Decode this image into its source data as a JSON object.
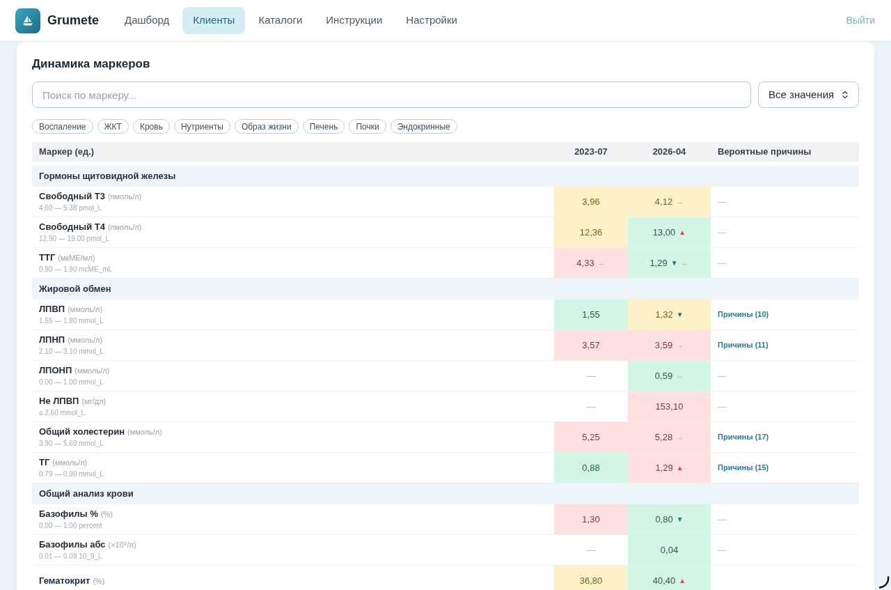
{
  "nav": {
    "brand": "Grumete",
    "items": [
      {
        "label": "Дашборд",
        "selected": false
      },
      {
        "label": "Клиенты",
        "selected": true
      },
      {
        "label": "Каталоги",
        "selected": false
      },
      {
        "label": "Инструкции",
        "selected": false
      },
      {
        "label": "Настройки",
        "selected": false
      }
    ],
    "logout": "Выйти"
  },
  "panel": {
    "title": "Динамика маркеров",
    "search": {
      "placeholder": "Поиск по маркеру..."
    },
    "filter": {
      "value": "Все значения"
    },
    "tags": [
      "Воспаление",
      "ЖКТ",
      "Кровь",
      "Нутриенты",
      "Образ жизни",
      "Печень",
      "Почки",
      "Эндокринные"
    ],
    "table": {
      "columns": [
        "Маркер (ед.)",
        "2023-07",
        "2026-04",
        "Вероятные причины"
      ],
      "groups": [
        {
          "name": "Гормоны щитовидной железы",
          "rows": [
            {
              "name": "Свободный Т3",
              "unit": "(пмоль/л)",
              "range": "4.60 — 5.38 pmol_L",
              "values": [
                {
                  "text": "3,96",
                  "color": "#fdf1c7"
                },
                {
                  "text": "4,12",
                  "color": "#fdf1c7",
                  "trends": [
                    {
                      "kind": "flat",
                      "symbol": "→"
                    }
                  ]
                }
              ],
              "causes": {
                "kind": "empty",
                "text": "—"
              }
            },
            {
              "name": "Свободный Т4",
              "unit": "(пмоль/л)",
              "range": "12.90 — 19.00 pmol_L",
              "values": [
                {
                  "text": "12,36",
                  "color": "#fdf1c7"
                },
                {
                  "text": "13,00",
                  "color": "#d3f5e5",
                  "trends": [
                    {
                      "kind": "up",
                      "symbol": "▲"
                    }
                  ]
                }
              ],
              "causes": {
                "kind": "empty",
                "text": "—"
              }
            },
            {
              "name": "ТТГ",
              "unit": "(мкМЕ/мл)",
              "range": "0.90 — 1.90 mcME_mL",
              "values": [
                {
                  "text": "4,33",
                  "color": "#fde1e1",
                  "trends": [
                    {
                      "kind": "range",
                      "symbol": "↔"
                    }
                  ]
                },
                {
                  "text": "1,29",
                  "color": "#d3f5e5",
                  "trends": [
                    {
                      "kind": "down",
                      "symbol": "▼"
                    },
                    {
                      "kind": "range",
                      "symbol": "↔"
                    }
                  ]
                }
              ],
              "causes": {
                "kind": "empty",
                "text": "—"
              }
            }
          ]
        },
        {
          "name": "Жировой обмен",
          "rows": [
            {
              "name": "ЛПВП",
              "unit": "(ммоль/л)",
              "range": "1.55 — 1.80 mmol_L",
              "values": [
                {
                  "text": "1,55",
                  "color": "#d3f5e5"
                },
                {
                  "text": "1,32",
                  "color": "#fdf1c7",
                  "trends": [
                    {
                      "kind": "down",
                      "symbol": "▼"
                    }
                  ]
                }
              ],
              "causes": {
                "kind": "link",
                "text": "Причины (10)"
              }
            },
            {
              "name": "ЛПНП",
              "unit": "(ммоль/л)",
              "range": "2.10 — 3.10 mmol_L",
              "values": [
                {
                  "text": "3,57",
                  "color": "#fde1e1"
                },
                {
                  "text": "3,59",
                  "color": "#fde1e1",
                  "trends": [
                    {
                      "kind": "flat",
                      "symbol": "→"
                    }
                  ]
                }
              ],
              "causes": {
                "kind": "link",
                "text": "Причины (11)"
              }
            },
            {
              "name": "ЛПОНП",
              "unit": "(ммоль/л)",
              "range": "0.00 — 1.00 mmol_L",
              "values": [
                {
                  "text": "—"
                },
                {
                  "text": "0,59",
                  "color": "#d3f5e5",
                  "trends": [
                    {
                      "kind": "range",
                      "symbol": "↔"
                    }
                  ]
                }
              ],
              "causes": {
                "kind": "empty",
                "text": "—"
              }
            },
            {
              "name": "Не ЛПВП",
              "unit": "(мг/дл)",
              "range": "≤ 2.60 mmol_L",
              "values": [
                {
                  "text": "—"
                },
                {
                  "text": "153,10",
                  "color": "#fde1e1"
                }
              ],
              "causes": {
                "kind": "empty",
                "text": "—"
              }
            },
            {
              "name": "Общий холестерин",
              "unit": "(ммоль/л)",
              "range": "3.90 — 5.69 mmol_L",
              "values": [
                {
                  "text": "5,25",
                  "color": "#fde1e1"
                },
                {
                  "text": "5,28",
                  "color": "#fde1e1",
                  "trends": [
                    {
                      "kind": "flat",
                      "symbol": "→"
                    }
                  ]
                }
              ],
              "causes": {
                "kind": "link",
                "text": "Причины (17)"
              }
            },
            {
              "name": "ТГ",
              "unit": "(ммоль/л)",
              "range": "0.79 — 0.90 mmol_L",
              "values": [
                {
                  "text": "0,88",
                  "color": "#d3f5e5"
                },
                {
                  "text": "1,29",
                  "color": "#fde1e1",
                  "trends": [
                    {
                      "kind": "up",
                      "symbol": "▲"
                    }
                  ]
                }
              ],
              "causes": {
                "kind": "link",
                "text": "Причины (15)"
              }
            }
          ]
        },
        {
          "name": "Общий анализ крови",
          "rows": [
            {
              "name": "Базофилы %",
              "unit": "(%)",
              "range": "0.00 — 1.00 percent",
              "values": [
                {
                  "text": "1,30",
                  "color": "#fde1e1"
                },
                {
                  "text": "0,80",
                  "color": "#d3f5e5",
                  "trends": [
                    {
                      "kind": "down",
                      "symbol": "▼"
                    }
                  ]
                }
              ],
              "causes": {
                "kind": "empty",
                "text": "—"
              }
            },
            {
              "name": "Базофилы абс",
              "unit": "(×10⁹/л)",
              "range": "0.01 — 0.09 10_9_L",
              "values": [
                {
                  "text": "—"
                },
                {
                  "text": "0,04",
                  "color": "#d3f5e5"
                }
              ],
              "causes": {
                "kind": "empty",
                "text": "—"
              }
            },
            {
              "name": "Гематокрит",
              "unit": "(%)",
              "values": [
                {
                  "text": "36,80",
                  "color": "#fdf1c7"
                },
                {
                  "text": "40,40",
                  "color": "#d3f5e5",
                  "trends": [
                    {
                      "kind": "up",
                      "symbol": "▲"
                    }
                  ]
                }
              ]
            }
          ]
        }
      ]
    }
  }
}
